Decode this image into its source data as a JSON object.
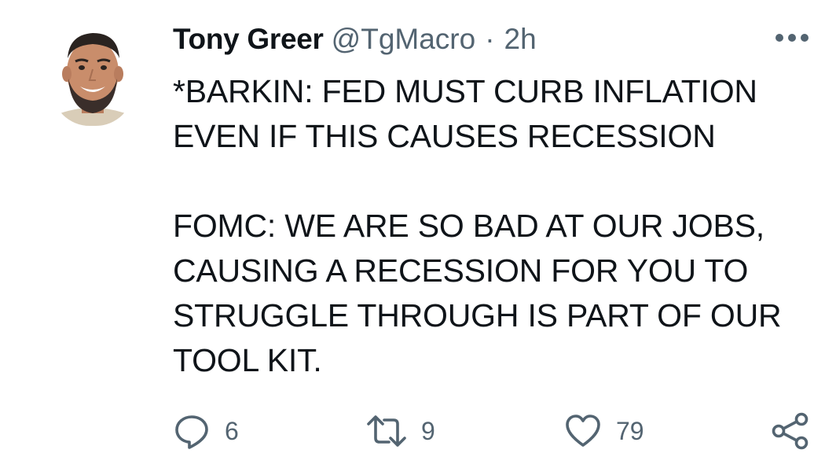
{
  "author": {
    "name": "Tony Greer",
    "handle": "@TgMacro",
    "separator": "·",
    "time": "2h"
  },
  "tweet": {
    "text": "*BARKIN: FED MUST CURB INFLATION\nEVEN IF THIS CAUSES RECESSION\n\nFOMC: WE ARE SO BAD AT OUR JOBS,\nCAUSING A RECESSION FOR YOU TO\nSTRUGGLE THROUGH IS PART OF OUR\nTOOL KIT."
  },
  "actions": {
    "reply": {
      "icon": "reply-icon",
      "count": "6"
    },
    "retweet": {
      "icon": "retweet-icon",
      "count": "9"
    },
    "like": {
      "icon": "heart-icon",
      "count": "79"
    },
    "share": {
      "icon": "share-icon"
    }
  },
  "colors": {
    "text_primary": "#0f1419",
    "text_secondary": "#536471",
    "background": "#ffffff"
  }
}
